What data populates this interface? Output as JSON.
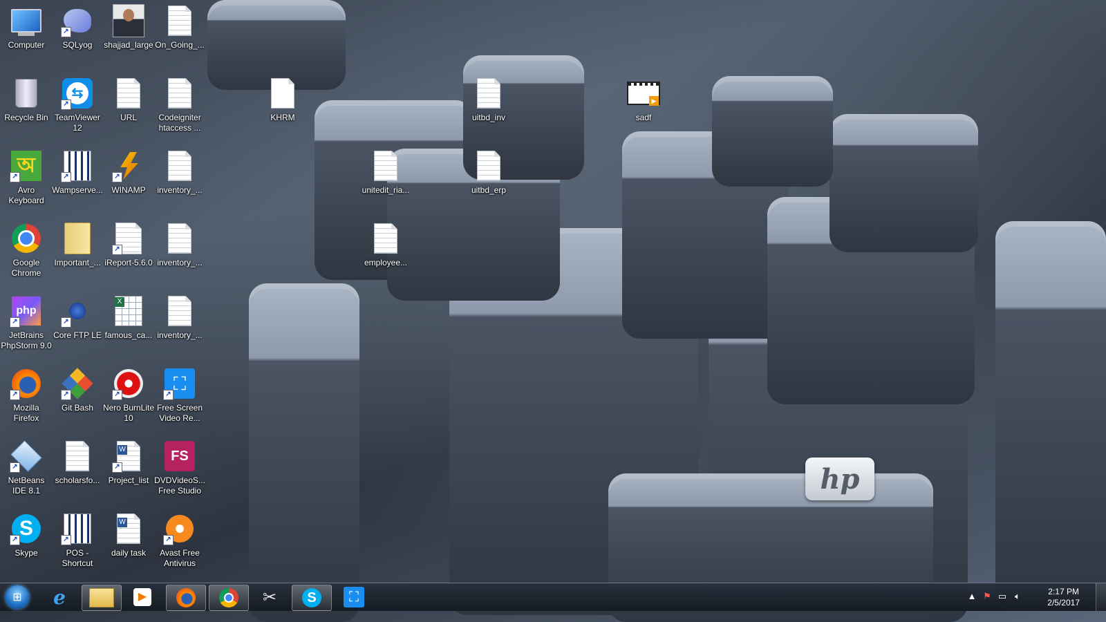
{
  "desktop": {
    "icons": [
      {
        "label": "Computer",
        "icon": "computer-icon"
      },
      {
        "label": "SQLyog",
        "icon": "sqlyog-icon"
      },
      {
        "label": "shajjad_large",
        "icon": "photo-thumbnail"
      },
      {
        "label": "On_Going_...",
        "icon": "document-icon"
      },
      {
        "label": "Recycle Bin",
        "icon": "recycle-bin-icon"
      },
      {
        "label": "TeamViewer 12",
        "icon": "teamviewer-icon"
      },
      {
        "label": "URL",
        "icon": "document-icon"
      },
      {
        "label": "Codeigniter htaccess ...",
        "icon": "document-icon"
      },
      {
        "label": "KHRM",
        "icon": "document-icon"
      },
      {
        "label": "uitbd_inv",
        "icon": "document-icon"
      },
      {
        "label": "sadf",
        "icon": "video-file-icon"
      },
      {
        "label": "Avro Keyboard",
        "icon": "avro-keyboard-icon"
      },
      {
        "label": "Wampserve...",
        "icon": "calendar-app-icon"
      },
      {
        "label": "WINAMP",
        "icon": "winamp-icon"
      },
      {
        "label": "inventory_...",
        "icon": "document-icon"
      },
      {
        "label": "unitedit_ria...",
        "icon": "document-icon"
      },
      {
        "label": "uitbd_erp",
        "icon": "document-icon"
      },
      {
        "label": "Google Chrome",
        "icon": "chrome-icon"
      },
      {
        "label": "Important_...",
        "icon": "folder-icon"
      },
      {
        "label": "iReport-5.6.0",
        "icon": "ireport-icon"
      },
      {
        "label": "inventory_...",
        "icon": "document-icon"
      },
      {
        "label": "employee...",
        "icon": "document-icon"
      },
      {
        "label": "JetBrains PhpStorm 9.0",
        "icon": "phpstorm-icon"
      },
      {
        "label": "Core FTP LE",
        "icon": "coreftp-icon"
      },
      {
        "label": "famous_ca...",
        "icon": "spreadsheet-icon"
      },
      {
        "label": "inventory_...",
        "icon": "document-icon"
      },
      {
        "label": "Mozilla Firefox",
        "icon": "firefox-icon"
      },
      {
        "label": "Git Bash",
        "icon": "git-bash-icon"
      },
      {
        "label": "Nero BurnLite 10",
        "icon": "nero-icon"
      },
      {
        "label": "Free Screen Video Re...",
        "icon": "screen-recorder-icon"
      },
      {
        "label": "NetBeans IDE 8.1",
        "icon": "netbeans-icon"
      },
      {
        "label": "scholarsfo...",
        "icon": "document-icon"
      },
      {
        "label": "Project_list",
        "icon": "word-doc-icon"
      },
      {
        "label": "DVDVideoS... Free Studio",
        "icon": "dvdvideosoft-icon"
      },
      {
        "label": "Skype",
        "icon": "skype-icon"
      },
      {
        "label": "POS - Shortcut",
        "icon": "calendar-app-icon"
      },
      {
        "label": "daily task",
        "icon": "word-doc-icon"
      },
      {
        "label": "Avast Free Antivirus",
        "icon": "avast-icon"
      }
    ]
  },
  "wallpaper": {
    "logo_text": "hp"
  },
  "taskbar": {
    "pinned": [
      {
        "name": "internet-explorer",
        "glyph": "e"
      },
      {
        "name": "windows-explorer",
        "glyph": "▤"
      },
      {
        "name": "media-player",
        "glyph": "▶"
      },
      {
        "name": "firefox",
        "glyph": "●"
      },
      {
        "name": "chrome",
        "glyph": "◉"
      },
      {
        "name": "snipping-tool",
        "glyph": "✂"
      },
      {
        "name": "skype",
        "glyph": "S"
      },
      {
        "name": "screen-recorder",
        "glyph": "⛶"
      }
    ],
    "clock": {
      "time": "2:17 PM",
      "date": "2/5/2017"
    }
  },
  "colors": {
    "taskbar": "#1c232d",
    "accent": "#1d6fc4"
  }
}
